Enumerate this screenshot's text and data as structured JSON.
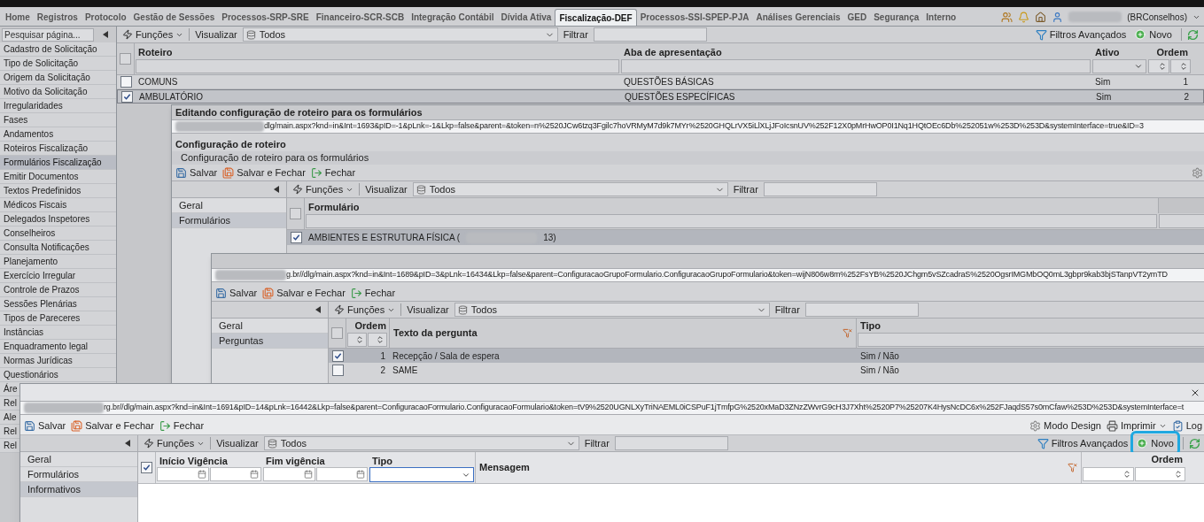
{
  "top_tabs": [
    {
      "label": "Home",
      "selected": false
    },
    {
      "label": "Registros",
      "selected": false
    },
    {
      "label": "Protocolo",
      "selected": false
    },
    {
      "label": "Gestão de Sessões",
      "selected": false
    },
    {
      "label": "Processos-SRP-SRE",
      "selected": false
    },
    {
      "label": "Financeiro-SCR-SCB",
      "selected": false
    },
    {
      "label": "Integração Contábil",
      "selected": false
    },
    {
      "label": "Dívida Ativa",
      "selected": false
    },
    {
      "label": "Fiscalização-DEF",
      "selected": true
    },
    {
      "label": "Processos-SSI-SPEP-PJA",
      "selected": false
    },
    {
      "label": "Análises Gerenciais",
      "selected": false
    },
    {
      "label": "GED",
      "selected": false
    },
    {
      "label": "Segurança",
      "selected": false
    },
    {
      "label": "Interno",
      "selected": false
    }
  ],
  "user": {
    "org": "(BRConselhos)"
  },
  "sidebar": {
    "search_placeholder": "Pesquisar página...",
    "items": [
      {
        "label": "Cadastro de Solicitação",
        "selected": false
      },
      {
        "label": "Tipo de Solicitação",
        "selected": false
      },
      {
        "label": "Origem da Solicitação",
        "selected": false
      },
      {
        "label": "Motivo da Solicitação",
        "selected": false
      },
      {
        "label": "Irregularidades",
        "selected": false
      },
      {
        "label": "Fases",
        "selected": false
      },
      {
        "label": "Andamentos",
        "selected": false
      },
      {
        "label": "Roteiros Fiscalização",
        "selected": false
      },
      {
        "label": "Formulários Fiscalização",
        "selected": true
      },
      {
        "label": "Emitir Documentos",
        "selected": false
      },
      {
        "label": "Textos Predefinidos",
        "selected": false
      },
      {
        "label": "Médicos Fiscais",
        "selected": false
      },
      {
        "label": "Delegados Inspetores",
        "selected": false
      },
      {
        "label": "Conselheiros",
        "selected": false
      },
      {
        "label": "Consulta Notificações",
        "selected": false
      },
      {
        "label": "Planejamento",
        "selected": false
      },
      {
        "label": "Exercício Irregular",
        "selected": false
      },
      {
        "label": "Controle de Prazos",
        "selected": false
      },
      {
        "label": "Sessões Plenárias",
        "selected": false
      },
      {
        "label": "Tipos de Pareceres",
        "selected": false
      },
      {
        "label": "Instâncias",
        "selected": false
      },
      {
        "label": "Enquadramento legal",
        "selected": false
      },
      {
        "label": "Normas Jurídicas",
        "selected": false
      },
      {
        "label": "Questionários",
        "selected": false
      },
      {
        "label": "Áre",
        "selected": false
      },
      {
        "label": "Rel",
        "selected": false
      },
      {
        "label": "Ale",
        "selected": false
      },
      {
        "label": "Rel",
        "selected": false
      },
      {
        "label": "Rel",
        "selected": false
      }
    ]
  },
  "main_grid": {
    "toolbar": {
      "functions": "Funções",
      "view_label": "Visualizar",
      "view_value": "Todos",
      "filter_label": "Filtrar",
      "advanced_filters": "Filtros Avançados",
      "new": "Novo",
      "new_highlighted": false
    },
    "select_all": {
      "checked": false
    },
    "columns": [
      "Roteiro",
      "Aba de apresentação",
      "Ativo",
      "Ordem"
    ],
    "rows": [
      {
        "checked": false,
        "selected": false,
        "cells": [
          "COMUNS",
          "QUESTÕES BÁSICAS",
          "Sim",
          "1"
        ]
      },
      {
        "checked": true,
        "selected": true,
        "cells": [
          "AMBULATÓRIO",
          "QUESTÕES ESPECÍFICAS",
          "Sim",
          "2"
        ]
      }
    ]
  },
  "dialog_roteiro": {
    "title": "Editando configuração de roteiro para os formulários",
    "url": "dlg/main.aspx?knd=in&Int=1693&pID=-1&pLnk=-1&Lkp=false&parent=&token=n%2520JCw6tzq3Fgilc7hoVRMyM7d9k7MYr%2520GHQLrVX5iLlXLjJFoIcsnUV%252F12X0pMrHwOP0I1Nq1HQtOEc6Db%252051w%253D%253D&systemInterface=true&ID=3",
    "heading": "Configuração de roteiro",
    "subheading": "Configuração de roteiro para os formulários",
    "actions": [
      {
        "kind": "save",
        "label": "Salvar"
      },
      {
        "kind": "save_close",
        "label": "Salvar e Fechar"
      },
      {
        "kind": "close",
        "label": "Fechar"
      }
    ],
    "side_tabs": [
      {
        "label": "Geral",
        "selected": false
      },
      {
        "label": "Formulários",
        "selected": true
      }
    ],
    "grid": {
      "toolbar": {
        "functions": "Funções",
        "view_label": "Visualizar",
        "view_value": "Todos",
        "filter_label": "Filtrar"
      },
      "select_all": {
        "checked": false
      },
      "columns": [
        "Formulário"
      ],
      "rows": [
        {
          "checked": true,
          "selected": true,
          "text_start": "AMBIENTES E ESTRUTURA FÍSICA (",
          "text_end": "13)"
        }
      ]
    }
  },
  "dialog_grupo": {
    "url": "g.br//dlg/main.aspx?knd=in&Int=1689&pID=3&pLnk=16434&Lkp=false&parent=ConfiguracaoGrupoFormulario.ConfiguracaoGrupoFormulario&token=wijN806w8m%252FsYB%2520JChgm5vSZcadraS%2520OgsrIMGMbOQ0mL3gbpr9kab3bjSTanpVT2ymTD",
    "actions": [
      {
        "kind": "save",
        "label": "Salvar"
      },
      {
        "kind": "save_close",
        "label": "Salvar e Fechar"
      },
      {
        "kind": "close",
        "label": "Fechar"
      }
    ],
    "side_tabs": [
      {
        "label": "Geral",
        "selected": false
      },
      {
        "label": "Perguntas",
        "selected": true
      }
    ],
    "grid": {
      "toolbar": {
        "functions": "Funções",
        "view_label": "Visualizar",
        "view_value": "Todos",
        "filter_label": "Filtrar"
      },
      "select_all": {
        "checked": false
      },
      "columns": [
        "Ordem",
        "Texto da pergunta",
        "Tipo"
      ],
      "rows": [
        {
          "checked": true,
          "selected": true,
          "cells": [
            "1",
            "Recepção / Sala de espera",
            "Sim / Não"
          ]
        },
        {
          "checked": false,
          "selected": false,
          "cells": [
            "2",
            "SAME",
            "Sim / Não"
          ]
        }
      ]
    }
  },
  "dialog_formulario": {
    "url": "rg.br//dlg/main.aspx?knd=in&Int=1691&pID=14&pLnk=16442&Lkp=false&parent=ConfiguracaoFormulario.ConfiguracaoFormulario&token=tV9%2520UGNLXyTriNAEML0iCSPuF1jTmfpG%2520xMaD3ZNzZWvrG9cH3J7Xht%2520P7%25207K4HysNcDC6x%252FJaqdS57s0mCfaw%253D%253D&systemInterface=t",
    "actions": [
      {
        "kind": "save",
        "label": "Salvar"
      },
      {
        "kind": "save_close",
        "label": "Salvar e Fechar"
      },
      {
        "kind": "close",
        "label": "Fechar"
      }
    ],
    "tools": [
      {
        "kind": "design",
        "label": "Modo Design"
      },
      {
        "kind": "print",
        "label": "Imprimir"
      },
      {
        "kind": "log",
        "label": "Log"
      }
    ],
    "side_tabs": [
      {
        "label": "Geral",
        "selected": false
      },
      {
        "label": "Formulários",
        "selected": false
      },
      {
        "label": "Informativos",
        "selected": true
      }
    ],
    "grid": {
      "toolbar": {
        "functions": "Funções",
        "view_label": "Visualizar",
        "view_value": "Todos",
        "filter_label": "Filtrar",
        "advanced_filters": "Filtros Avançados",
        "new": "Novo",
        "new_highlighted": true
      },
      "select_all": {
        "checked": true
      },
      "columns": [
        "Início Vigência",
        "Fim vigência",
        "Tipo",
        "Mensagem",
        "Ordem"
      ]
    }
  }
}
